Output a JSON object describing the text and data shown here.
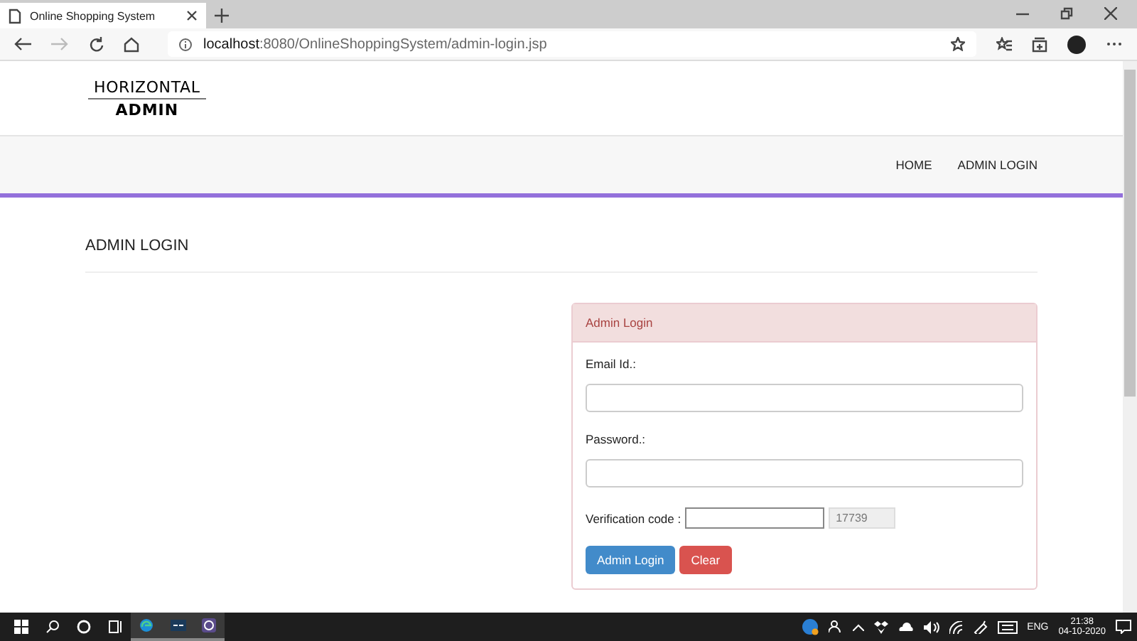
{
  "browser": {
    "tab_title": "Online Shopping System",
    "url_host": "localhost",
    "url_path": ":8080/OnlineShoppingSystem/admin-login.jsp"
  },
  "header": {
    "logo_top": "HORIZONTAL",
    "logo_bottom": "ADMIN"
  },
  "nav": [
    {
      "label": "HOME"
    },
    {
      "label": "ADMIN LOGIN"
    }
  ],
  "page_title": "ADMIN LOGIN",
  "panel": {
    "title": "Admin Login",
    "fields": [
      {
        "label": "Email Id.:"
      },
      {
        "label": "Password.:"
      }
    ],
    "verification": {
      "label": "Verification code :",
      "code": "17739"
    },
    "buttons": [
      {
        "label": "Admin Login",
        "kind": "primary"
      },
      {
        "label": "Clear",
        "kind": "danger"
      }
    ]
  },
  "taskbar": {
    "language": "ENG",
    "time": "21:38",
    "date": "04-10-2020"
  }
}
